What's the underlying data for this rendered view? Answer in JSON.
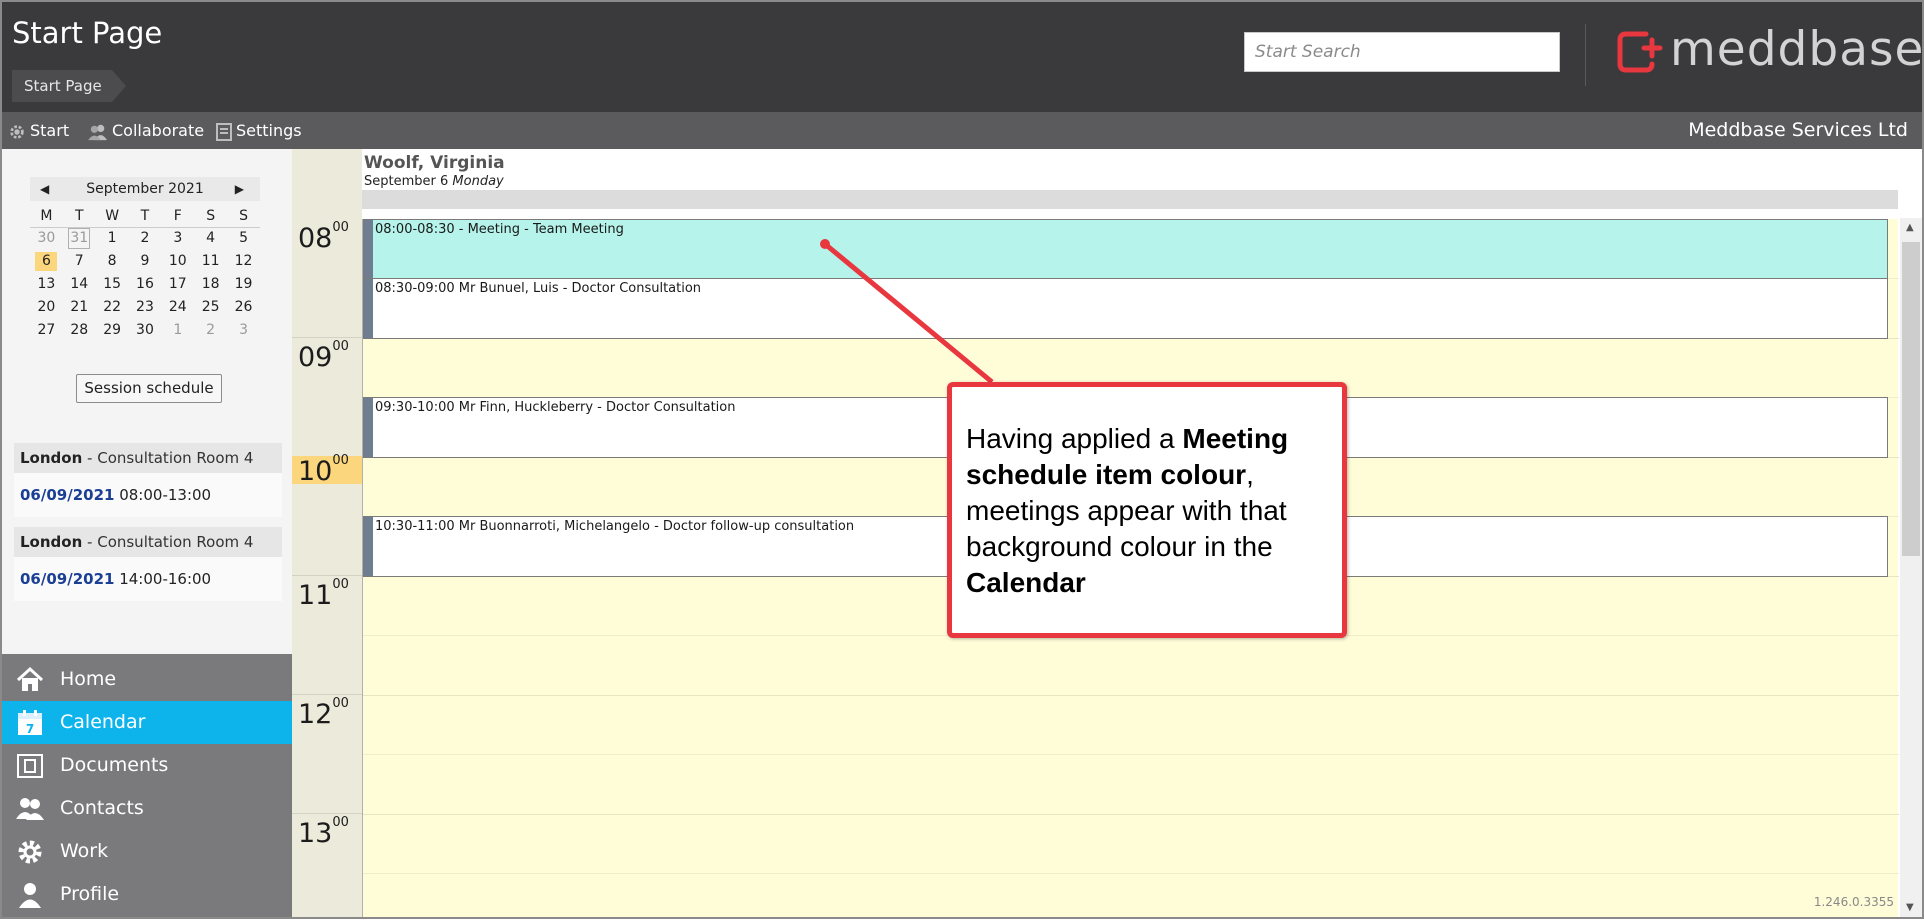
{
  "header": {
    "page_title": "Start Page",
    "breadcrumb": "Start Page",
    "search_placeholder": "Start Search",
    "logo_text": "meddbase",
    "logo_registered": "®",
    "brand_color": "#e8373f"
  },
  "toolbar": {
    "items": [
      {
        "label": "Start",
        "icon": "gear-icon"
      },
      {
        "label": "Collaborate",
        "icon": "people-icon"
      },
      {
        "label": "Settings",
        "icon": "settings-panel-icon"
      }
    ],
    "company": "Meddbase Services Ltd"
  },
  "mini_calendar": {
    "month_label": "September 2021",
    "prev": "◀",
    "next": "▶",
    "weekdays": [
      "M",
      "T",
      "W",
      "T",
      "F",
      "S",
      "S"
    ],
    "weeks": [
      [
        "30",
        "31",
        "1",
        "2",
        "3",
        "4",
        "5"
      ],
      [
        "6",
        "7",
        "8",
        "9",
        "10",
        "11",
        "12"
      ],
      [
        "13",
        "14",
        "15",
        "16",
        "17",
        "18",
        "19"
      ],
      [
        "20",
        "21",
        "22",
        "23",
        "24",
        "25",
        "26"
      ],
      [
        "27",
        "28",
        "29",
        "30",
        "1",
        "2",
        "3"
      ]
    ],
    "selected_day": "6"
  },
  "session_schedule_button": "Session schedule",
  "sessions": [
    {
      "site": "London",
      "room": " - Consultation Room 4",
      "date": "06/09/2021",
      "time": " 08:00-13:00"
    },
    {
      "site": "London",
      "room": " - Consultation Room 4",
      "date": "06/09/2021",
      "time": " 14:00-16:00"
    }
  ],
  "nav": {
    "items": [
      {
        "label": "Home",
        "icon": "home-icon"
      },
      {
        "label": "Calendar",
        "icon": "calendar-icon",
        "active": true
      },
      {
        "label": "Documents",
        "icon": "documents-icon"
      },
      {
        "label": "Contacts",
        "icon": "contacts-icon"
      },
      {
        "label": "Work",
        "icon": "gear-icon"
      },
      {
        "label": "Profile",
        "icon": "person-icon"
      }
    ],
    "active_color": "#0db4ec"
  },
  "calendar": {
    "name": "Woolf, Virginia",
    "date": "September 6",
    "weekday": "Monday",
    "hours": [
      {
        "h": "08",
        "m": "00"
      },
      {
        "h": "09",
        "m": "00"
      },
      {
        "h": "10",
        "m": "00",
        "current": true
      },
      {
        "h": "11",
        "m": "00"
      },
      {
        "h": "12",
        "m": "00"
      },
      {
        "h": "13",
        "m": "00"
      }
    ],
    "appointments": [
      {
        "text": "08:00-08:30 - Meeting - Team Meeting",
        "type": "meeting",
        "start": "08:00",
        "end": "08:30"
      },
      {
        "text": "08:30-09:00 Mr Bunuel, Luis - Doctor Consultation",
        "type": "appointment",
        "start": "08:30",
        "end": "09:00"
      },
      {
        "text": "09:30-10:00 Mr Finn, Huckleberry - Doctor Consultation",
        "type": "appointment",
        "start": "09:30",
        "end": "10:00"
      },
      {
        "text": "10:30-11:00 Mr Buonnarroti, Michelangelo - Doctor follow-up consultation",
        "type": "appointment",
        "start": "10:30",
        "end": "11:00"
      }
    ],
    "meeting_color": "#b6f3ea",
    "session_bg_color": "#fffdd8"
  },
  "version": "1.246.0.3355",
  "callout": {
    "p1": "Having applied a ",
    "b1": "Meeting schedule item colour",
    "p2": ", meetings appear with that background colour in the ",
    "b2": "Calendar"
  }
}
